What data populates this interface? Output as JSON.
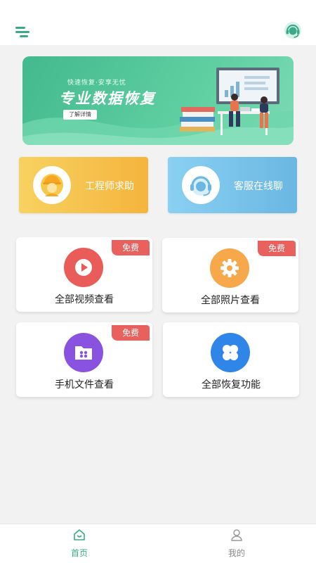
{
  "header": {
    "menu_icon": "menu-icon",
    "support_icon": "customer-service-icon",
    "accent_color": "#3aaa88"
  },
  "banner": {
    "subtitle": "快速恢复·安享无忧",
    "title": "专业数据恢复",
    "button_label": "了解详情"
  },
  "help_cards": [
    {
      "label": "工程师求助",
      "icon": "engineer-icon"
    },
    {
      "label": "客服在线聊",
      "icon": "customer-service-icon"
    }
  ],
  "features": [
    {
      "title": "全部视频查看",
      "badge": "免费",
      "icon": "play-icon",
      "color": "#ea5c5a"
    },
    {
      "title": "全部照片查看",
      "badge": "免费",
      "icon": "gear-icon",
      "color": "#f7a84a"
    },
    {
      "title": "手机文件查看",
      "badge": "免费",
      "icon": "folder-icon",
      "color": "#8a52e0"
    },
    {
      "title": "全部恢复功能",
      "icon": "clover-icon",
      "color": "#2f86e8"
    }
  ],
  "tabbar": {
    "items": [
      {
        "label": "首页",
        "icon": "home-icon",
        "active": true
      },
      {
        "label": "我的",
        "icon": "user-icon",
        "active": false
      }
    ]
  }
}
